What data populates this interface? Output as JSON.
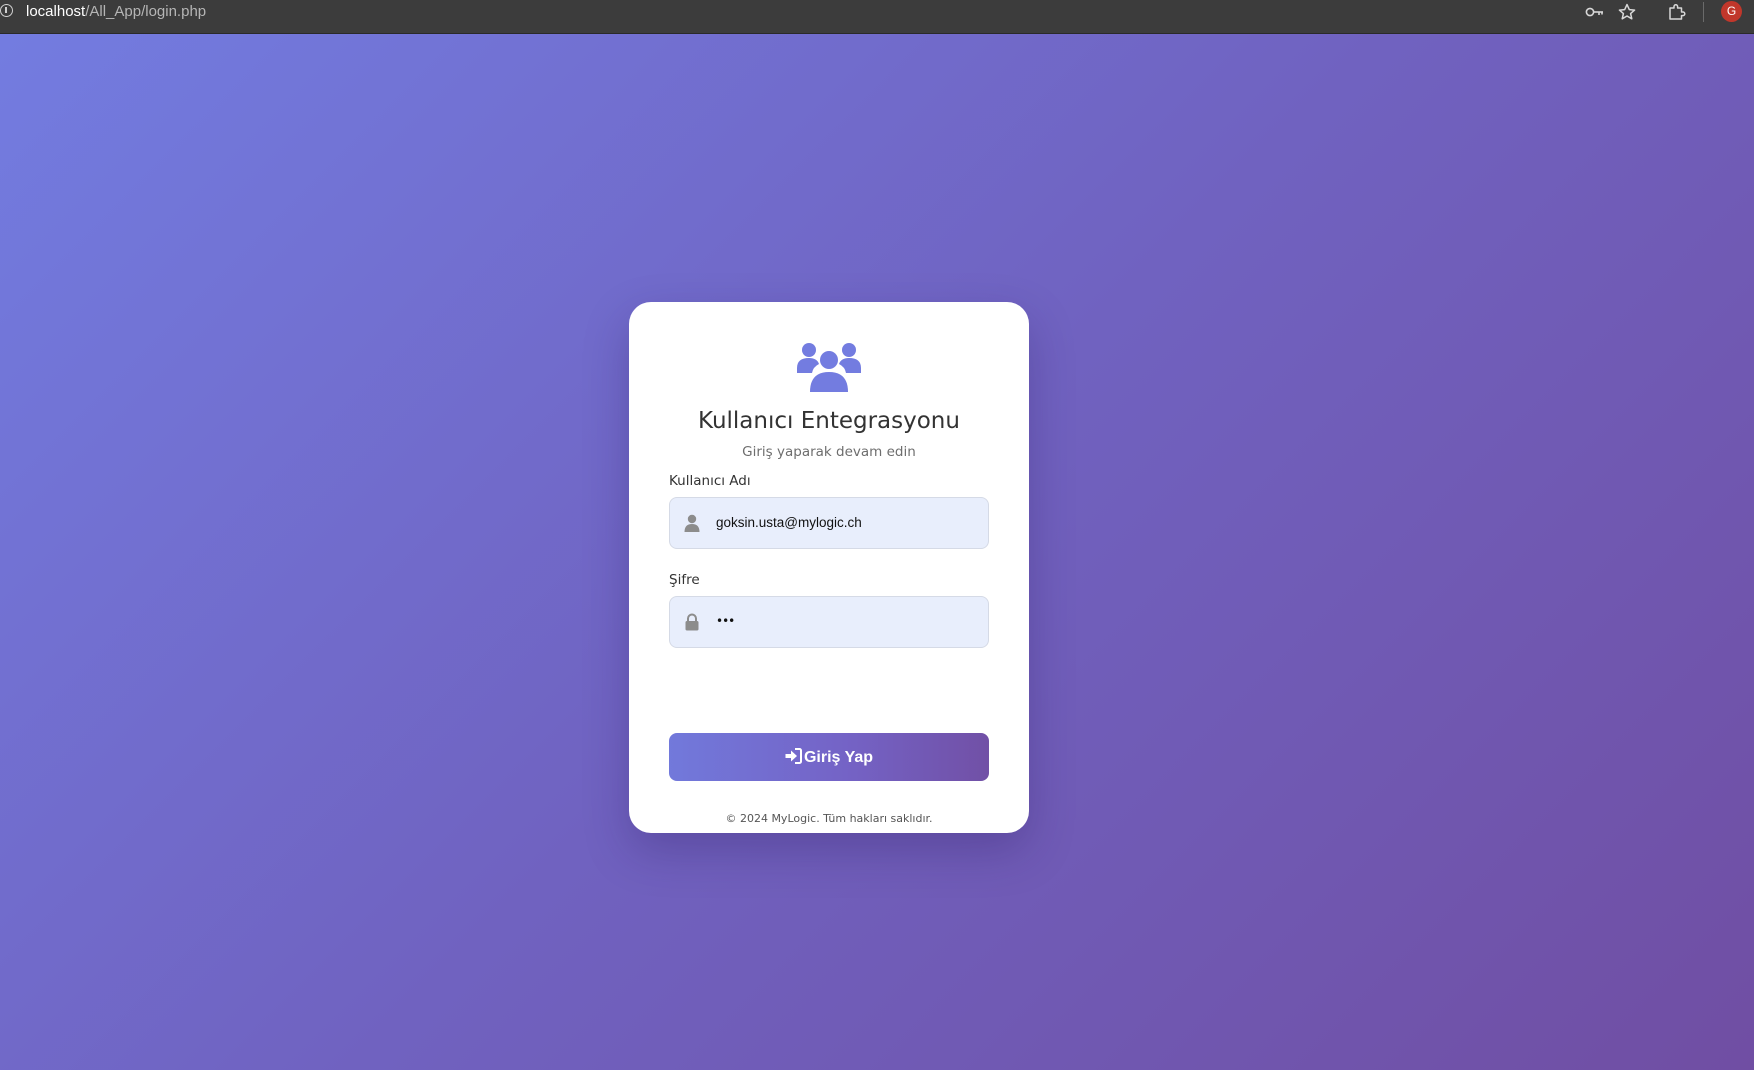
{
  "browser": {
    "url_host": "localhost",
    "url_path": "/All_App/login.php",
    "avatar_initial": "G"
  },
  "login": {
    "title": "Kullanıcı Entegrasyonu",
    "subtitle": "Giriş yaparak devam edin",
    "username_label": "Kullanıcı Adı",
    "username_value": "goksin.usta@mylogic.ch",
    "password_label": "Şifre",
    "password_masked": "•••",
    "submit_label": "Giriş Yap",
    "footer": "© 2024 MyLogic. Tüm hakları saklıdır."
  },
  "colors": {
    "accent": "#737ce0",
    "background_start": "#737ce0",
    "background_end": "#704ea3",
    "field_background": "#e8eefc",
    "avatar": "#c1372b"
  },
  "icons": {
    "header": "users-icon",
    "username": "user-icon",
    "password": "lock-icon",
    "submit": "sign-in-icon"
  }
}
